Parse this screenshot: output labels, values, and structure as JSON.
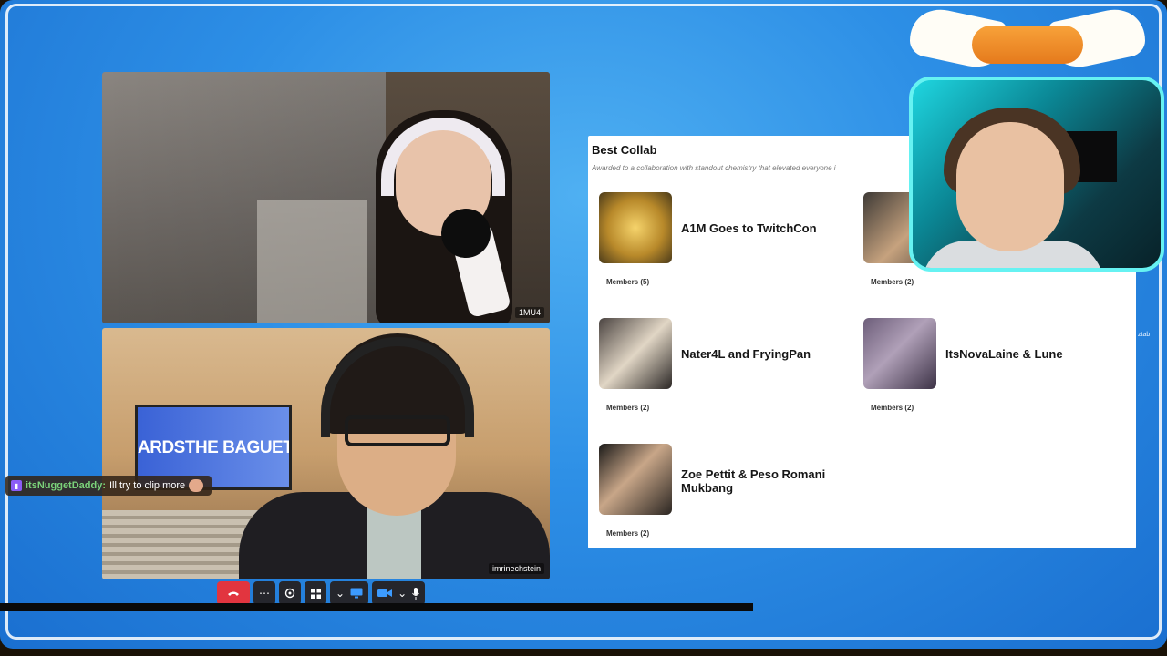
{
  "chat": {
    "username": "itsNuggetDaddy:",
    "message": "Ill try to clip more"
  },
  "videos": {
    "top_tag": "1MU4",
    "bottom_tag": "imrinechstein",
    "tv_banner": "ARDSTHE BAGUETTE AV"
  },
  "controls": {
    "more": "⋯",
    "dropdown": "⌄"
  },
  "panel": {
    "title": "Best Collab",
    "subtitle": "Awarded to a collaboration with standout chemistry that elevated everyone i",
    "cards": [
      {
        "name": "A1M Goes to TwitchCon",
        "members": "Members (5)"
      },
      {
        "name": "",
        "members": "Members (2)"
      },
      {
        "name": "Nater4L and FryingPan",
        "members": "Members (2)"
      },
      {
        "name": "ItsNovaLaine & Lune",
        "members": "Members (2)"
      },
      {
        "name": "Zoe Pettit & Peso Romani Mukbang",
        "members": "Members (2)"
      }
    ]
  },
  "side_text": "ztab",
  "colors": {
    "background": "#2d8fe6",
    "hangup": "#e2353f",
    "webcam_border": "#66f2f2",
    "chat_username": "#7bd27a"
  }
}
